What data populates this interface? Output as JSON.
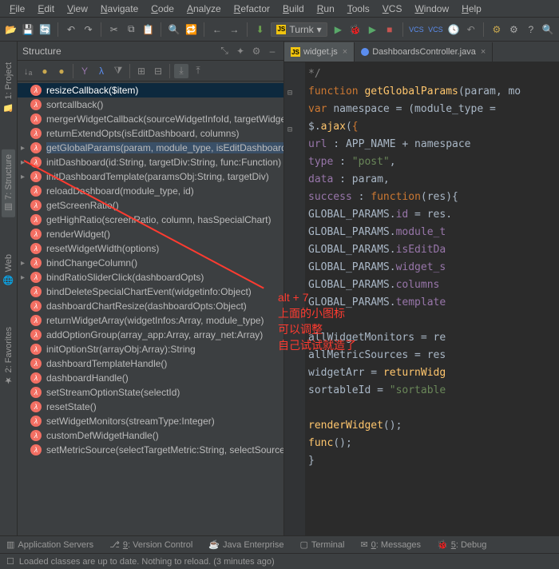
{
  "menu": [
    "File",
    "Edit",
    "View",
    "Navigate",
    "Code",
    "Analyze",
    "Refactor",
    "Build",
    "Run",
    "Tools",
    "VCS",
    "Window",
    "Help"
  ],
  "run_config": "Turnk",
  "structure": {
    "title": "Structure",
    "items": [
      {
        "label": "resizeCallback($item)",
        "selected": true
      },
      {
        "label": "sortcallback()"
      },
      {
        "label": "mergerWidgetCallback(sourceWidgetInfoId, targetWidgetInfoId)"
      },
      {
        "label": "returnExtendOpts(isEditDashboard, columns)"
      },
      {
        "label": "getGlobalParams(param, module_type, isEditDashboard, func:Function)",
        "expand": true,
        "hl": true
      },
      {
        "label": "initDashboard(id:String, targetDiv:String, func:Function)",
        "expand": true
      },
      {
        "label": "initDashboardTemplate(paramsObj:String, targetDiv)",
        "expand": true
      },
      {
        "label": "reloadDashboard(module_type, id)"
      },
      {
        "label": "getScreenRatio()"
      },
      {
        "label": "getHighRatio(screenRatio, column, hasSpecialChart)"
      },
      {
        "label": "renderWidget()"
      },
      {
        "label": "resetWidgetWidth(options)"
      },
      {
        "label": "bindChangeColumn()",
        "expand": true
      },
      {
        "label": "bindRatioSliderClick(dashboardOpts)",
        "expand": true
      },
      {
        "label": "bindDeleteSpecialChartEvent(widgetinfo:Object)"
      },
      {
        "label": "dashboardChartResize(dashboardOpts:Object)"
      },
      {
        "label": "returnWidgetArray(widgetInfos:Array, module_type)"
      },
      {
        "label": "addOptionGroup(array_app:Array, array_net:Array)"
      },
      {
        "label": "initOptionStr(arrayObj:Array):String"
      },
      {
        "label": "dashboardTemplateHandle()"
      },
      {
        "label": "dashboardHandle()"
      },
      {
        "label": "setStreamOptionState(selectId)"
      },
      {
        "label": "resetState()"
      },
      {
        "label": "setWidgetMonitors(streamType:Integer)"
      },
      {
        "label": "customDefWidgetHandle()"
      },
      {
        "label": "setMetricSource(selectTargetMetric:String, selectSourceMetric)"
      }
    ]
  },
  "tabs": [
    {
      "name": "widget.js",
      "type": "js",
      "active": true
    },
    {
      "name": "DashboardsController.java",
      "type": "java"
    }
  ],
  "code_lines": [
    {
      "t": "   */",
      "cls": "cm"
    },
    {
      "t": "function getGlobalParams(param, mo",
      "parts": [
        [
          "kw",
          "function "
        ],
        [
          "fn",
          "getGlobalParams"
        ],
        [
          "",
          "(param, mo"
        ]
      ]
    },
    {
      "t": "    var namespace = (module_type =",
      "parts": [
        [
          "",
          "    "
        ],
        [
          "kw",
          "var "
        ],
        [
          "",
          "namespace = (module_type ="
        ]
      ]
    },
    {
      "t": "    $.ajax({",
      "parts": [
        [
          "",
          "    $."
        ],
        [
          "fn",
          "ajax"
        ],
        [
          "",
          "("
        ],
        [
          "kw",
          "{"
        ]
      ]
    },
    {
      "t": "        url : APP_NAME + namespace",
      "parts": [
        [
          "",
          "        "
        ],
        [
          "prop",
          "url"
        ],
        [
          "",
          " : APP_NAME + namespace"
        ]
      ]
    },
    {
      "t": "        type : \"post\",",
      "parts": [
        [
          "",
          "        "
        ],
        [
          "prop",
          "type"
        ],
        [
          "",
          " : "
        ],
        [
          "str",
          "\"post\""
        ],
        [
          "",
          ","
        ]
      ]
    },
    {
      "t": "        data : param,",
      "parts": [
        [
          "",
          "        "
        ],
        [
          "prop",
          "data"
        ],
        [
          "",
          " : param,"
        ]
      ]
    },
    {
      "t": "        success : function(res){",
      "parts": [
        [
          "",
          "        "
        ],
        [
          "prop",
          "success"
        ],
        [
          "",
          " : "
        ],
        [
          "kw",
          "function"
        ],
        [
          "",
          "(res){"
        ]
      ]
    },
    {
      "t": "            GLOBAL_PARAMS.id = res.",
      "parts": [
        [
          "",
          "            GLOBAL_PARAMS."
        ],
        [
          "prop",
          "id"
        ],
        [
          "",
          " = res."
        ]
      ]
    },
    {
      "t": "            GLOBAL_PARAMS.module_t",
      "parts": [
        [
          "",
          "            GLOBAL_PARAMS."
        ],
        [
          "prop",
          "module_t"
        ]
      ]
    },
    {
      "t": "            GLOBAL_PARAMS.isEditDa",
      "parts": [
        [
          "",
          "            GLOBAL_PARAMS."
        ],
        [
          "prop",
          "isEditDa"
        ]
      ]
    },
    {
      "t": "            GLOBAL_PARAMS.widget_s",
      "parts": [
        [
          "",
          "            GLOBAL_PARAMS."
        ],
        [
          "prop",
          "widget_s"
        ]
      ]
    },
    {
      "t": "            GLOBAL_PARAMS.columns ",
      "parts": [
        [
          "",
          "            GLOBAL_PARAMS."
        ],
        [
          "prop",
          "columns "
        ]
      ]
    },
    {
      "t": "            GLOBAL_PARAMS.template",
      "parts": [
        [
          "",
          "            GLOBAL_PARAMS."
        ],
        [
          "prop",
          "template"
        ]
      ]
    },
    {
      "t": ""
    },
    {
      "t": "            allWidgetMonitors = re",
      "parts": [
        [
          "",
          "            allWidgetMonitors = re"
        ]
      ]
    },
    {
      "t": "            allMetricSources = res",
      "parts": [
        [
          "",
          "            allMetricSources = res"
        ]
      ]
    },
    {
      "t": "            widgetArr = returnWidg",
      "parts": [
        [
          "",
          "            widgetArr = "
        ],
        [
          "fn",
          "returnWidg"
        ]
      ]
    },
    {
      "t": "            sortableId = \"sortable",
      "parts": [
        [
          "",
          "            sortableId = "
        ],
        [
          "str",
          "\"sortable"
        ]
      ]
    },
    {
      "t": ""
    },
    {
      "t": "            renderWidget();",
      "parts": [
        [
          "",
          "            "
        ],
        [
          "fn",
          "renderWidget"
        ],
        [
          "",
          "();"
        ]
      ]
    },
    {
      "t": "            func();",
      "parts": [
        [
          "",
          "            "
        ],
        [
          "fn",
          "func"
        ],
        [
          "",
          "();"
        ]
      ]
    },
    {
      "t": "        }"
    }
  ],
  "annotations": {
    "line1": "alt + 7",
    "line2": "上面的小图标",
    "line3": "可以调整",
    "line4": "自己试试就造了"
  },
  "bottom_tools": [
    {
      "icon": "server",
      "label": "Application Servers"
    },
    {
      "icon": "vcs",
      "label": "9: Version Control"
    },
    {
      "icon": "java",
      "label": "Java Enterprise"
    },
    {
      "icon": "terminal",
      "label": "Terminal"
    },
    {
      "icon": "msg",
      "label": "0: Messages"
    },
    {
      "icon": "debug",
      "label": "5: Debug"
    }
  ],
  "status": "Loaded classes are up to date. Nothing to reload. (3 minutes ago)"
}
